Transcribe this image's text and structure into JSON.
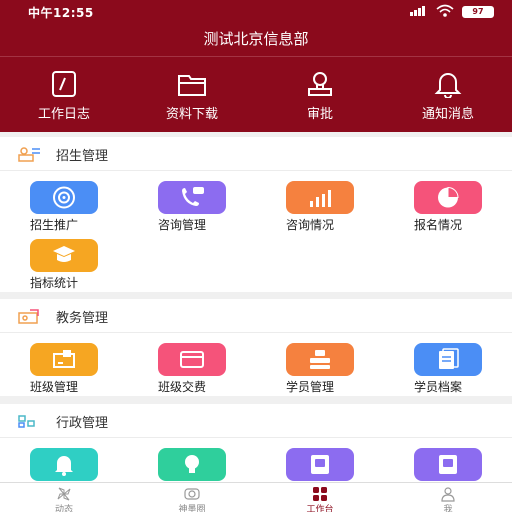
{
  "status_bar": {
    "time": "中午12:55",
    "battery": "97"
  },
  "header": {
    "title": "测试北京信息部"
  },
  "quick_actions": [
    {
      "label": "工作日志",
      "icon": "notebook-icon"
    },
    {
      "label": "资料下载",
      "icon": "folder-icon"
    },
    {
      "label": "审批",
      "icon": "stamp-icon"
    },
    {
      "label": "通知消息",
      "icon": "bell-icon"
    }
  ],
  "sections": [
    {
      "title": "招生管理",
      "items": [
        {
          "label": "招生推广",
          "color": "#4b8ef5",
          "icon": "target-icon"
        },
        {
          "label": "咨询管理",
          "color": "#8c6cf0",
          "icon": "phone-chat-icon"
        },
        {
          "label": "咨询情况",
          "color": "#f5813f",
          "icon": "bar-chart-icon"
        },
        {
          "label": "报名情况",
          "color": "#f5537a",
          "icon": "pie-chart-icon"
        },
        {
          "label": "指标统计",
          "color": "#f6a622",
          "icon": "graduate-icon"
        }
      ]
    },
    {
      "title": "教务管理",
      "items": [
        {
          "label": "班级管理",
          "color": "#f6a622",
          "icon": "classroom-icon"
        },
        {
          "label": "班级交费",
          "color": "#f5537a",
          "icon": "card-icon"
        },
        {
          "label": "学员管理",
          "color": "#f5813f",
          "icon": "student-icon"
        },
        {
          "label": "学员档案",
          "color": "#4b8ef5",
          "icon": "file-icon"
        }
      ]
    },
    {
      "title": "行政管理",
      "items": [
        {
          "label": "",
          "color": "#2fcfc4",
          "icon": "bell-icon"
        },
        {
          "label": "",
          "color": "#2fcf9c",
          "icon": "bulb-icon"
        },
        {
          "label": "",
          "color": "#8c6cf0",
          "icon": "doc-chat-icon"
        },
        {
          "label": "",
          "color": "#8c6cf0",
          "icon": "doc-chat-icon"
        }
      ]
    }
  ],
  "tab_bar": [
    {
      "label": "动态",
      "icon": "pinwheel-icon",
      "active": false
    },
    {
      "label": "神墨圈",
      "icon": "circle-camera-icon",
      "active": false
    },
    {
      "label": "工作台",
      "icon": "grid-icon",
      "active": true
    },
    {
      "label": "我",
      "icon": "person-icon",
      "active": false
    }
  ],
  "colors": {
    "brand": "#8b0a1c",
    "accent_icon": "#f0a050"
  }
}
